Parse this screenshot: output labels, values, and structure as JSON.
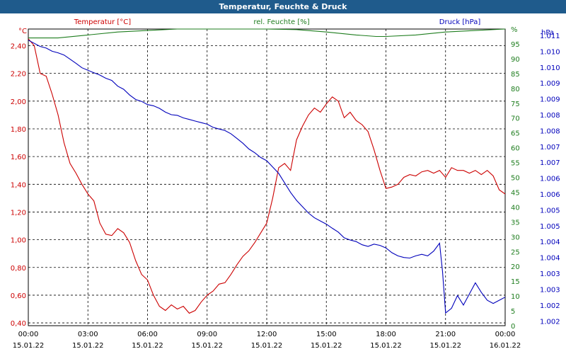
{
  "title": "Temperatur, Feuchte & Druck",
  "chart_data": {
    "type": "line",
    "grid": true,
    "background": "#ffffff",
    "x_ticks": [
      {
        "time": "00:00",
        "date": "15.01.22"
      },
      {
        "time": "03:00",
        "date": "15.01.22"
      },
      {
        "time": "06:00",
        "date": "15.01.22"
      },
      {
        "time": "09:00",
        "date": "15.01.22"
      },
      {
        "time": "12:00",
        "date": "15.01.22"
      },
      {
        "time": "15:00",
        "date": "15.01.22"
      },
      {
        "time": "18:00",
        "date": "15.01.22"
      },
      {
        "time": "21:00",
        "date": "15.01.22"
      },
      {
        "time": "00:00",
        "date": "16.01.22"
      }
    ],
    "x_range_hours": [
      0,
      24
    ],
    "axes": {
      "temperature": {
        "label": "Temperatur [°C]",
        "unit": "°C",
        "color": "#cc0000",
        "side": "left",
        "range": [
          0.38,
          2.52
        ],
        "ticks": [
          "0,40",
          "0,60",
          "0,80",
          "1,00",
          "1,20",
          "1,40",
          "1,60",
          "1,80",
          "2,00",
          "2,20",
          "2,40"
        ],
        "tick_values": [
          0.4,
          0.6,
          0.8,
          1.0,
          1.2,
          1.4,
          1.6,
          1.8,
          2.0,
          2.2,
          2.4
        ]
      },
      "humidity": {
        "label": "rel. Feuchte [%]",
        "unit": "%",
        "color": "#1e7d1e",
        "side": "right",
        "range": [
          0,
          100
        ],
        "ticks": [
          "0",
          "5",
          "10",
          "15",
          "20",
          "25",
          "30",
          "35",
          "40",
          "45",
          "50",
          "55",
          "60",
          "65",
          "70",
          "75",
          "80",
          "85",
          "90",
          "95",
          "%"
        ],
        "tick_values": [
          0,
          5,
          10,
          15,
          20,
          25,
          30,
          35,
          40,
          45,
          50,
          55,
          60,
          65,
          70,
          75,
          80,
          85,
          90,
          95,
          100
        ]
      },
      "pressure": {
        "label": "Druck [hPa]",
        "unit": "hPa",
        "color": "#0000bb",
        "side": "right",
        "range": [
          1001.85,
          1011.2
        ],
        "ticks": [
          "1.002",
          "1.002",
          "1.003",
          "1.003",
          "1.004",
          "1.004",
          "1.005",
          "1.005",
          "1.006",
          "1.006",
          "1.007",
          "1.007",
          "1.008",
          "1.008",
          "1.009",
          "1.009",
          "1.010",
          "1.010",
          "1.011",
          "1.011"
        ],
        "tick_values": [
          1002.0,
          1002.5,
          1003.0,
          1003.5,
          1004.0,
          1004.5,
          1005.0,
          1005.5,
          1006.0,
          1006.5,
          1007.0,
          1007.5,
          1008.0,
          1008.5,
          1009.0,
          1009.5,
          1010.0,
          1010.5,
          1011.0,
          1011.5
        ]
      }
    },
    "series": [
      {
        "name": "Temperatur [°C]",
        "axis": "temperature",
        "color": "#cc0000",
        "x": [
          0,
          0.3,
          0.6,
          0.9,
          1.2,
          1.5,
          1.8,
          2.1,
          2.4,
          2.7,
          3.0,
          3.3,
          3.6,
          3.9,
          4.2,
          4.5,
          4.8,
          5.1,
          5.4,
          5.7,
          6.0,
          6.3,
          6.6,
          6.9,
          7.2,
          7.5,
          7.8,
          8.1,
          8.4,
          8.7,
          9.0,
          9.3,
          9.6,
          9.9,
          10.2,
          10.5,
          10.8,
          11.1,
          11.4,
          11.7,
          12.0,
          12.3,
          12.6,
          12.9,
          13.2,
          13.5,
          13.8,
          14.1,
          14.4,
          14.7,
          15.0,
          15.3,
          15.6,
          15.9,
          16.2,
          16.5,
          16.8,
          17.1,
          17.4,
          17.7,
          18.0,
          18.3,
          18.6,
          18.9,
          19.2,
          19.5,
          19.8,
          20.1,
          20.4,
          20.7,
          21.0,
          21.3,
          21.6,
          21.9,
          22.2,
          22.5,
          22.8,
          23.1,
          23.4,
          23.7,
          24.0
        ],
        "values": [
          2.45,
          2.4,
          2.2,
          2.18,
          2.05,
          1.9,
          1.7,
          1.55,
          1.48,
          1.4,
          1.33,
          1.28,
          1.12,
          1.04,
          1.03,
          1.08,
          1.05,
          0.98,
          0.85,
          0.75,
          0.71,
          0.6,
          0.52,
          0.49,
          0.53,
          0.5,
          0.52,
          0.47,
          0.49,
          0.55,
          0.6,
          0.63,
          0.68,
          0.69,
          0.75,
          0.82,
          0.88,
          0.92,
          0.98,
          1.05,
          1.12,
          1.3,
          1.52,
          1.55,
          1.5,
          1.72,
          1.82,
          1.9,
          1.95,
          1.92,
          1.98,
          2.03,
          2.0,
          1.88,
          1.92,
          1.86,
          1.83,
          1.78,
          1.65,
          1.5,
          1.37,
          1.38,
          1.4,
          1.45,
          1.47,
          1.46,
          1.49,
          1.5,
          1.48,
          1.5,
          1.45,
          1.52,
          1.5,
          1.5,
          1.48,
          1.5,
          1.47,
          1.5,
          1.46,
          1.36,
          1.33
        ],
        "style": "solid"
      },
      {
        "name": "rel. Feuchte [%]",
        "axis": "humidity",
        "color": "#1e7d1e",
        "x": [
          0,
          1.5,
          3,
          4.5,
          6,
          7.5,
          9,
          10.5,
          12,
          13.5,
          15,
          16.5,
          17.5,
          18,
          19.5,
          21,
          22.5,
          24
        ],
        "values": [
          97,
          97,
          98,
          99,
          99.5,
          100,
          100,
          100,
          100,
          99.8,
          99,
          98,
          97.5,
          97.5,
          98,
          99,
          99.5,
          100
        ],
        "style": "solid"
      },
      {
        "name": "Druck [hPa]",
        "axis": "pressure",
        "color": "#0000bb",
        "x": [
          0,
          0.3,
          0.6,
          0.9,
          1.2,
          1.5,
          1.8,
          2.1,
          2.4,
          2.7,
          3.0,
          3.3,
          3.6,
          3.9,
          4.2,
          4.5,
          4.8,
          5.1,
          5.4,
          5.7,
          6.0,
          6.3,
          6.6,
          6.9,
          7.2,
          7.5,
          7.8,
          8.1,
          8.4,
          8.7,
          9.0,
          9.3,
          9.6,
          9.9,
          10.2,
          10.5,
          10.8,
          11.1,
          11.4,
          11.7,
          12.0,
          12.3,
          12.6,
          12.9,
          13.2,
          13.5,
          13.8,
          14.1,
          14.4,
          14.7,
          15.0,
          15.3,
          15.6,
          15.9,
          16.2,
          16.5,
          16.8,
          17.1,
          17.4,
          17.7,
          18.0,
          18.3,
          18.6,
          18.9,
          19.2,
          19.5,
          19.8,
          20.1,
          20.4,
          20.7,
          20.85,
          21.0,
          21.3,
          21.6,
          21.9,
          22.2,
          22.5,
          22.8,
          23.1,
          23.4,
          23.7,
          24.0
        ],
        "values": [
          1010.85,
          1010.75,
          1010.65,
          1010.6,
          1010.5,
          1010.45,
          1010.38,
          1010.25,
          1010.12,
          1009.98,
          1009.9,
          1009.82,
          1009.75,
          1009.65,
          1009.58,
          1009.4,
          1009.3,
          1009.12,
          1008.98,
          1008.92,
          1008.82,
          1008.78,
          1008.7,
          1008.58,
          1008.5,
          1008.48,
          1008.4,
          1008.35,
          1008.3,
          1008.25,
          1008.2,
          1008.1,
          1008.05,
          1008.0,
          1007.9,
          1007.75,
          1007.6,
          1007.42,
          1007.3,
          1007.15,
          1007.05,
          1006.85,
          1006.65,
          1006.35,
          1006.05,
          1005.8,
          1005.6,
          1005.4,
          1005.25,
          1005.15,
          1005.05,
          1004.92,
          1004.8,
          1004.62,
          1004.55,
          1004.5,
          1004.4,
          1004.35,
          1004.42,
          1004.38,
          1004.3,
          1004.15,
          1004.05,
          1004.0,
          1003.98,
          1004.05,
          1004.1,
          1004.05,
          1004.2,
          1004.45,
          1003.55,
          1002.25,
          1002.4,
          1002.8,
          1002.5,
          1002.85,
          1003.2,
          1002.9,
          1002.65,
          1002.55,
          1002.65,
          1002.75
        ],
        "style": "solid"
      }
    ]
  }
}
